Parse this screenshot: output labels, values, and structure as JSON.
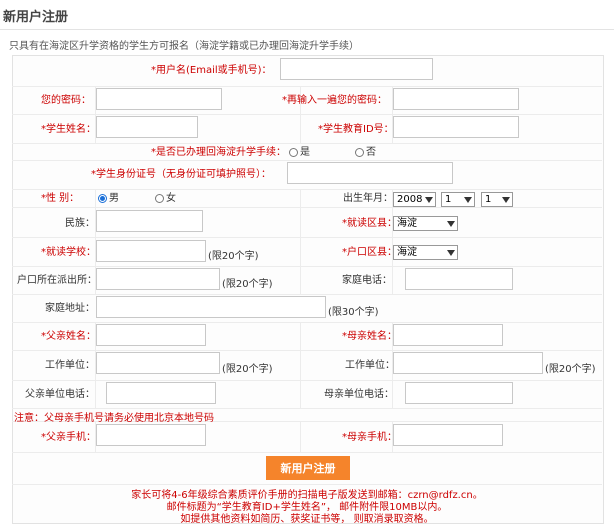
{
  "page": {
    "title": "新用户注册",
    "notice": "只具有在海淀区升学资格的学生方可报名（海淀学籍或已办理回海淀升学手续）"
  },
  "fields": {
    "username": {
      "label": "*用户名(Email或手机号)：",
      "value": ""
    },
    "password": {
      "label": "您的密码：",
      "value": ""
    },
    "password_confirm": {
      "label": "*再输入一遍您的密码：",
      "value": ""
    },
    "student_name": {
      "label": "*学生姓名：",
      "value": ""
    },
    "student_edu_id": {
      "label": "*学生教育ID号：",
      "value": ""
    },
    "transfer_done": {
      "label": "*是否已办理回海淀升学手续：",
      "options": [
        "是",
        "否"
      ],
      "selected": ""
    },
    "id_number": {
      "label": "*学生身份证号（无身份证可填护照号）：",
      "value": ""
    },
    "gender": {
      "label": "*性  别：",
      "options": [
        "男",
        "女"
      ],
      "selected": "男"
    },
    "birth": {
      "label": "出生年月：",
      "year": "2008",
      "month": "1",
      "day": "1"
    },
    "ethnicity": {
      "label": "民族：",
      "value": ""
    },
    "school_district": {
      "label": "*就读区县：",
      "value": "海淀"
    },
    "school": {
      "label": "*就读学校：",
      "value": "",
      "hint": "(限20个字)"
    },
    "hukou_district": {
      "label": "*户口区县：",
      "value": "海淀"
    },
    "police_station": {
      "label": "户口所在派出所：",
      "value": "",
      "hint": "(限20个字)"
    },
    "home_phone": {
      "label": "家庭电话：",
      "value": ""
    },
    "home_address": {
      "label": "家庭地址：",
      "value": "",
      "hint": "(限30个字)"
    },
    "father_name": {
      "label": "*父亲姓名：",
      "value": ""
    },
    "mother_name": {
      "label": "*母亲姓名：",
      "value": ""
    },
    "father_work": {
      "label": "工作单位：",
      "value": "",
      "hint": "(限20个字)"
    },
    "mother_work": {
      "label": "工作单位：",
      "value": "",
      "hint": "(限20个字)"
    },
    "father_work_phone": {
      "label": "父亲单位电话：",
      "value": ""
    },
    "mother_work_phone": {
      "label": "母亲单位电话：",
      "value": ""
    },
    "father_mobile": {
      "label": "*父亲手机：",
      "value": ""
    },
    "mother_mobile": {
      "label": "*母亲手机：",
      "value": ""
    }
  },
  "warning": "注意：父母亲手机号请务必使用北京本地号码",
  "submit_label": "新用户注册",
  "footer": [
    "家长可将4-6年级综合素质评价手册的扫描电子版发送到邮箱：czrn@rdfz.cn。",
    "邮件标题为“学生教育ID+学生姓名”， 邮件附件限10MB以内。",
    "如提供其他资料如简历、获奖证书等， 则取消录取资格。"
  ],
  "colors": {
    "required": "#cc0000",
    "submit": "#f5842b"
  }
}
